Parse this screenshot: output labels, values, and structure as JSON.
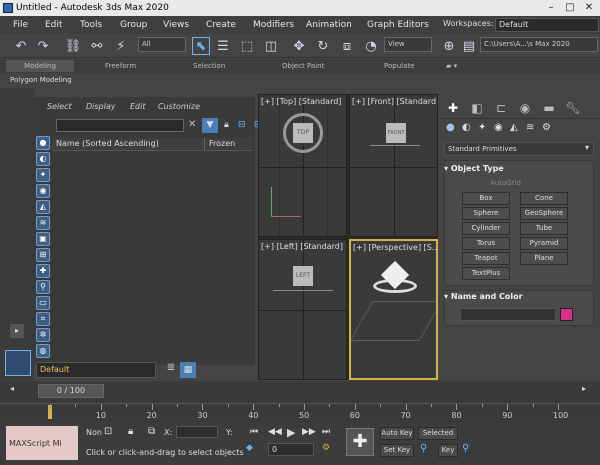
{
  "title": "Untitled - Autodesk 3ds Max 2020",
  "window_buttons": [
    "–",
    "□",
    "✕"
  ],
  "menus": [
    "File",
    "Edit",
    "Tools",
    "Group",
    "Views",
    "Create",
    "Modifiers",
    "Animation",
    "Graph Editors"
  ],
  "workspace_label": "Workspaces:",
  "workspace_value": "Default",
  "toolbar": {
    "filter": "All",
    "view": "View",
    "path": "C:\\Users\\A...\\s Max 2020"
  },
  "ribbon_tabs": [
    "Modeling",
    "Freeform",
    "Selection",
    "Object Paint",
    "Populate"
  ],
  "ribbon_sub": "Polygon Modeling",
  "explorer": {
    "menus": [
      "Select",
      "Display",
      "Edit",
      "Customize"
    ],
    "col_name": "Name (Sorted Ascending)",
    "col_frozen": "Frozen",
    "layer": "Default"
  },
  "viewports": {
    "top": "[+] [Top] [Standard]",
    "front": "[+] [Front] [Standard]",
    "left": "[+] [Left] [Standard]",
    "persp": "[+] [Perspective] [S...",
    "cube_top": "TOP",
    "cube_front": "FRONT",
    "cube_left": "LEFT"
  },
  "command_panel": {
    "category": "Standard Primitives",
    "object_type": "Object Type",
    "autogrid": "AutoGrid",
    "buttons": [
      [
        "Box",
        "Cone"
      ],
      [
        "Sphere",
        "GeoSphere"
      ],
      [
        "Cylinder",
        "Tube"
      ],
      [
        "Torus",
        "Pyramid"
      ],
      [
        "Teapot",
        "Plane"
      ],
      [
        "TextPlus",
        ""
      ]
    ],
    "name_color": "Name and Color",
    "swatch": "#d6318a"
  },
  "timeline": {
    "frame": "0 / 100",
    "ticks": [
      "10",
      "20",
      "30",
      "40",
      "50",
      "60",
      "70",
      "80",
      "90",
      "100"
    ]
  },
  "status": {
    "maxscript": "MAXScript Mi",
    "none": "Non",
    "x_label": "X:",
    "y_label": "Y:",
    "prompt": "Click or click-and-drag to select objects",
    "auto_key": "Auto Key",
    "selected": "Selected",
    "set_key": "Set Key",
    "key_filters": "Key",
    "frame": "0"
  },
  "colors": {
    "accent": "#6fb0ef",
    "active_border": "#d8b04a"
  }
}
